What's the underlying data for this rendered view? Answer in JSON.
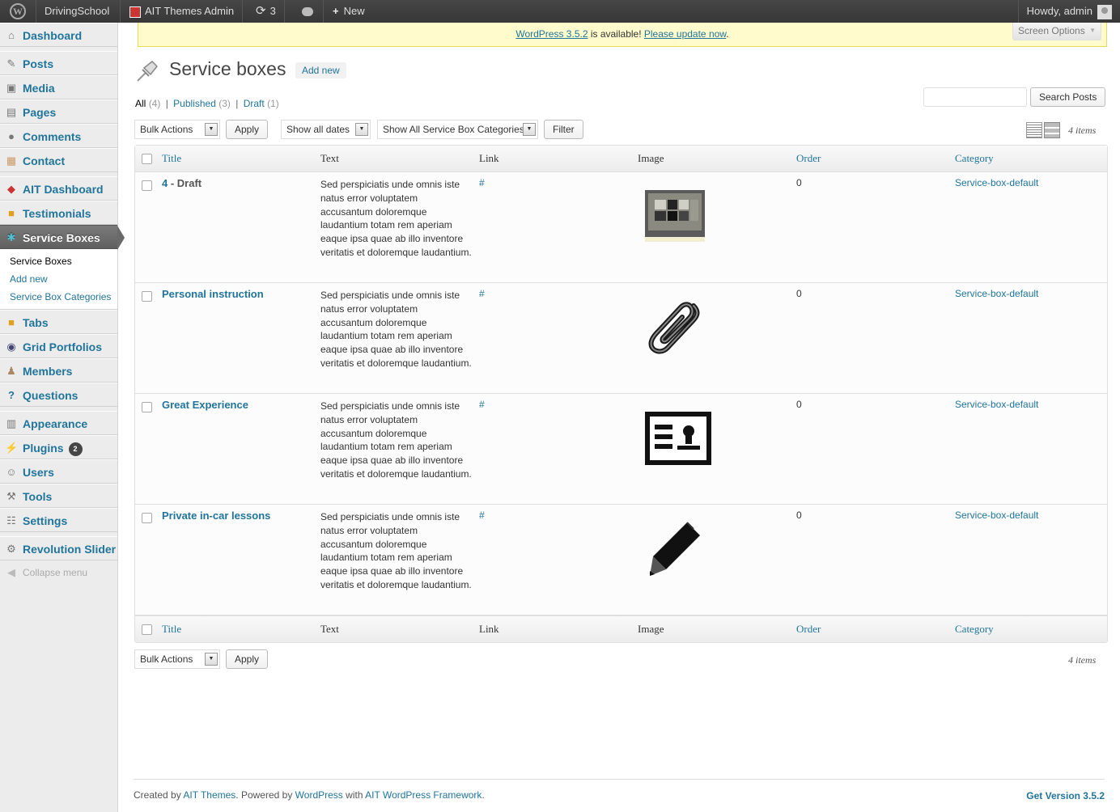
{
  "adminbar": {
    "site_name": "DrivingSchool",
    "ait_admin": "AIT Themes Admin",
    "updates_count": "3",
    "new_label": "New",
    "howdy": "Howdy, admin"
  },
  "sidebar": {
    "items": [
      {
        "label": "Dashboard",
        "icon": "home-icon"
      },
      {
        "label": "Posts",
        "icon": "pin-icon"
      },
      {
        "label": "Media",
        "icon": "media-icon"
      },
      {
        "label": "Pages",
        "icon": "pages-icon"
      },
      {
        "label": "Comments",
        "icon": "comments-icon"
      },
      {
        "label": "Contact",
        "icon": "contact-icon"
      },
      {
        "label": "AIT Dashboard",
        "icon": "ait-icon"
      },
      {
        "label": "Testimonials",
        "icon": "box-icon"
      },
      {
        "label": "Service Boxes",
        "icon": "service-box-icon"
      },
      {
        "label": "Tabs",
        "icon": "tabs-icon"
      },
      {
        "label": "Grid Portfolios",
        "icon": "portfolio-icon"
      },
      {
        "label": "Members",
        "icon": "members-icon"
      },
      {
        "label": "Questions",
        "icon": "question-icon"
      },
      {
        "label": "Appearance",
        "icon": "appearance-icon"
      },
      {
        "label": "Plugins",
        "icon": "plugins-icon",
        "badge": "2"
      },
      {
        "label": "Users",
        "icon": "users-icon"
      },
      {
        "label": "Tools",
        "icon": "tools-icon"
      },
      {
        "label": "Settings",
        "icon": "settings-icon"
      },
      {
        "label": "Revolution Slider",
        "icon": "gear-icon"
      }
    ],
    "submenu": [
      "Service Boxes",
      "Add new",
      "Service Box Categories"
    ],
    "collapse": "Collapse menu"
  },
  "notice": {
    "link1": "WordPress 3.5.2",
    "middle": " is available! ",
    "link2": "Please update now",
    "end": "."
  },
  "screen_options": "Screen Options",
  "page": {
    "title": "Service boxes",
    "add_new": "Add new"
  },
  "views": {
    "all": "All",
    "all_count": "(4)",
    "published": "Published",
    "published_count": "(3)",
    "draft": "Draft",
    "draft_count": "(1)"
  },
  "search": {
    "button": "Search Posts",
    "value": ""
  },
  "filters": {
    "bulk_actions": "Bulk Actions",
    "apply": "Apply",
    "dates": "Show all dates",
    "categories": "Show All Service Box Categories",
    "filter": "Filter",
    "items_count": "4 items"
  },
  "table": {
    "columns": [
      "Title",
      "Text",
      "Link",
      "Image",
      "Order",
      "Category"
    ],
    "rows": [
      {
        "title": "4",
        "state": " - Draft",
        "text": "Sed perspiciatis unde omnis iste natus error voluptatem accusantum doloremque laudantium totam rem aperiam eaque ipsa quae ab illo inventore veritatis et doloremque laudantium.",
        "link": "#",
        "image": "calendar-icon",
        "order": "0",
        "category": "Service-box-default"
      },
      {
        "title": "Personal instruction",
        "state": "",
        "text": "Sed perspiciatis unde omnis iste natus error voluptatem accusantum doloremque laudantium totam rem aperiam eaque ipsa quae ab illo inventore veritatis et doloremque laudantium.",
        "link": "#",
        "image": "paperclip-icon",
        "order": "0",
        "category": "Service-box-default"
      },
      {
        "title": "Great Experience",
        "state": "",
        "text": "Sed perspiciatis unde omnis iste natus error voluptatem accusantum doloremque laudantium totam rem aperiam eaque ipsa quae ab illo inventore veritatis et doloremque laudantium.",
        "link": "#",
        "image": "id-card-icon",
        "order": "0",
        "category": "Service-box-default"
      },
      {
        "title": "Private in-car lessons",
        "state": "",
        "text": "Sed perspiciatis unde omnis iste natus error voluptatem accusantum doloremque laudantium totam rem aperiam eaque ipsa quae ab illo inventore veritatis et doloremque laudantium.",
        "link": "#",
        "image": "pencil-icon",
        "order": "0",
        "category": "Service-box-default"
      }
    ]
  },
  "footer": {
    "created_by": "Created by ",
    "ait": "AIT Themes",
    "powered": ". Powered by ",
    "wordpress": "WordPress",
    "with": " with ",
    "framework": "AIT WordPress Framework",
    "end": ".",
    "version": "Get Version 3.5.2"
  }
}
